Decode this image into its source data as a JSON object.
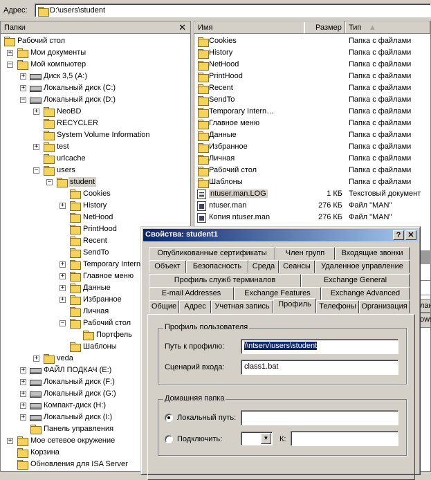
{
  "address": {
    "label": "Адрес:",
    "path": "D:\\users\\student"
  },
  "folders_pane": {
    "title": "Папки",
    "close": "✕"
  },
  "tree": [
    {
      "label": "Рабочий стол",
      "icon": "desktop-icon"
    },
    {
      "label": "Мои документы",
      "icon": "my-documents-icon"
    },
    {
      "label": "Мой компьютер",
      "icon": "my-computer-icon"
    },
    {
      "label": "Диск 3,5 (A:)",
      "icon": "floppy-icon"
    },
    {
      "label": "Локальный диск (C:)",
      "icon": "drive-icon"
    },
    {
      "label": "Локальный диск (D:)",
      "icon": "drive-icon"
    },
    {
      "label": "NeoBD",
      "icon": "folder-icon"
    },
    {
      "label": "RECYCLER",
      "icon": "folder-icon"
    },
    {
      "label": "System Volume Information",
      "icon": "folder-icon"
    },
    {
      "label": "test",
      "icon": "folder-icon"
    },
    {
      "label": "urlcache",
      "icon": "folder-icon"
    },
    {
      "label": "users",
      "icon": "folder-icon"
    },
    {
      "label": "student",
      "icon": "open-folder-icon"
    },
    {
      "label": "Cookies",
      "icon": "folder-icon"
    },
    {
      "label": "History",
      "icon": "folder-icon"
    },
    {
      "label": "NetHood",
      "icon": "folder-icon"
    },
    {
      "label": "PrintHood",
      "icon": "folder-icon"
    },
    {
      "label": "Recent",
      "icon": "folder-icon"
    },
    {
      "label": "SendTo",
      "icon": "folder-icon"
    },
    {
      "label": "Temporary Intern",
      "icon": "folder-icon"
    },
    {
      "label": "Главное меню",
      "icon": "folder-icon"
    },
    {
      "label": "Данные",
      "icon": "folder-icon"
    },
    {
      "label": "Избранное",
      "icon": "folder-icon"
    },
    {
      "label": "Личная",
      "icon": "folder-icon"
    },
    {
      "label": "Рабочий стол",
      "icon": "folder-icon"
    },
    {
      "label": "Портфель",
      "icon": "briefcase-icon"
    },
    {
      "label": "Шаблоны",
      "icon": "folder-icon"
    },
    {
      "label": "veda",
      "icon": "folder-icon"
    },
    {
      "label": "ФАЙЛ ПОДКАЧ (E:)",
      "icon": "drive-icon"
    },
    {
      "label": "Локальный диск (F:)",
      "icon": "drive-icon"
    },
    {
      "label": "Локальный диск (G:)",
      "icon": "drive-icon"
    },
    {
      "label": "Компакт-диск (H:)",
      "icon": "cdrom-icon"
    },
    {
      "label": "Локальный диск (I:)",
      "icon": "drive-icon"
    },
    {
      "label": "Панель управления",
      "icon": "control-panel-icon"
    },
    {
      "label": "Мое сетевое окружение",
      "icon": "network-icon"
    },
    {
      "label": "Корзина",
      "icon": "recycle-bin-icon"
    },
    {
      "label": "Обновления для ISA Server",
      "icon": "folder-icon"
    }
  ],
  "file_list": {
    "columns": {
      "name": "Имя",
      "size": "Размер",
      "type": "Тип"
    },
    "rows": [
      {
        "name": "Cookies",
        "size": "",
        "type": "Папка с файлами",
        "icon": "folder-icon"
      },
      {
        "name": "History",
        "size": "",
        "type": "Папка с файлами",
        "icon": "folder-icon"
      },
      {
        "name": "NetHood",
        "size": "",
        "type": "Папка с файлами",
        "icon": "folder-icon"
      },
      {
        "name": "PrintHood",
        "size": "",
        "type": "Папка с файлами",
        "icon": "folder-icon"
      },
      {
        "name": "Recent",
        "size": "",
        "type": "Папка с файлами",
        "icon": "folder-icon"
      },
      {
        "name": "SendTo",
        "size": "",
        "type": "Папка с файлами",
        "icon": "folder-icon"
      },
      {
        "name": "Temporary Intern…",
        "size": "",
        "type": "Папка с файлами",
        "icon": "folder-icon"
      },
      {
        "name": "Главное меню",
        "size": "",
        "type": "Папка с файлами",
        "icon": "folder-icon"
      },
      {
        "name": "Данные",
        "size": "",
        "type": "Папка с файлами",
        "icon": "folder-icon"
      },
      {
        "name": "Избранное",
        "size": "",
        "type": "Папка с файлами",
        "icon": "folder-icon"
      },
      {
        "name": "Личная",
        "size": "",
        "type": "Папка с файлами",
        "icon": "folder-icon"
      },
      {
        "name": "Рабочий стол",
        "size": "",
        "type": "Папка с файлами",
        "icon": "folder-icon"
      },
      {
        "name": "Шаблоны",
        "size": "",
        "type": "Папка с файлами",
        "icon": "folder-icon"
      },
      {
        "name": "ntuser.man.LOG",
        "size": "1 КБ",
        "type": "Текстовый документ",
        "icon": "text-file-icon"
      },
      {
        "name": "ntuser.man",
        "size": "276 КБ",
        "type": "Файл \"MAN\"",
        "icon": "file-icon"
      },
      {
        "name": "Копия ntuser.man",
        "size": "276 КБ",
        "type": "Файл \"MAN\"",
        "icon": "file-icon"
      }
    ]
  },
  "dialog": {
    "title": "Свойства: student1",
    "help": "?",
    "close": "✕",
    "tabs_row1": [
      "Опубликованные сертификаты",
      "Член групп",
      "Входящие звонки"
    ],
    "tabs_row2": [
      "Объект",
      "Безопасность",
      "Среда",
      "Сеансы",
      "Удаленное управление"
    ],
    "tabs_row3": [
      "Профиль служб терминалов",
      "Exchange General"
    ],
    "tabs_row4": [
      "E-mail Addresses",
      "Exchange Features",
      "Exchange Advanced"
    ],
    "tabs_row5": [
      "Общие",
      "Адрес",
      "Учетная запись",
      "Профиль",
      "Телефоны",
      "Организация"
    ],
    "profile_group": "Профиль пользователя",
    "profile_path_label": "Путь к профилю:",
    "profile_path_value": "\\\\ntserv\\users\\student",
    "logon_script_label": "Сценарий входа:",
    "logon_script_value": "class1.bat",
    "home_group": "Домашняя папка",
    "local_path_label": "Локальный путь:",
    "local_path_value": "",
    "connect_label": "Подключить:",
    "drive_value": "",
    "to_label": "К:",
    "to_value": ""
  },
  "background_fragments": {
    "a": "ланс",
    "b": "ows"
  }
}
